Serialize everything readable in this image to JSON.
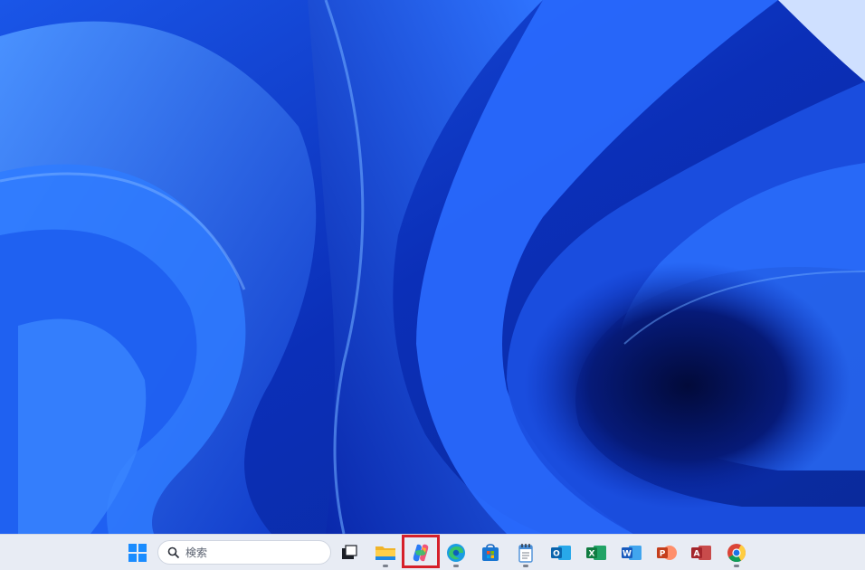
{
  "desktop": {
    "wallpaper": "windows-11-bloom-blue",
    "colors": {
      "base": "#0a2a9a",
      "light": "#3f86ff",
      "dark": "#031056"
    }
  },
  "taskbar": {
    "search": {
      "label": "検索",
      "icon": "search-icon"
    },
    "items": [
      {
        "name": "start",
        "icon": "windows-logo-icon"
      },
      {
        "name": "task-view",
        "icon": "task-view-icon"
      },
      {
        "name": "file-explorer",
        "icon": "folder-icon"
      },
      {
        "name": "copilot",
        "icon": "copilot-icon"
      },
      {
        "name": "edge",
        "icon": "edge-icon"
      },
      {
        "name": "microsoft-store",
        "icon": "store-icon"
      },
      {
        "name": "notepad",
        "icon": "notepad-icon"
      },
      {
        "name": "outlook",
        "icon": "outlook-icon",
        "letter": "O"
      },
      {
        "name": "excel",
        "icon": "excel-icon",
        "letter": "X"
      },
      {
        "name": "word",
        "icon": "word-icon",
        "letter": "W"
      },
      {
        "name": "powerpoint",
        "icon": "powerpoint-icon",
        "letter": "P"
      },
      {
        "name": "access",
        "icon": "access-icon",
        "letter": "A"
      },
      {
        "name": "chrome",
        "icon": "chrome-icon"
      }
    ],
    "highlight_color": "#d6202a"
  }
}
